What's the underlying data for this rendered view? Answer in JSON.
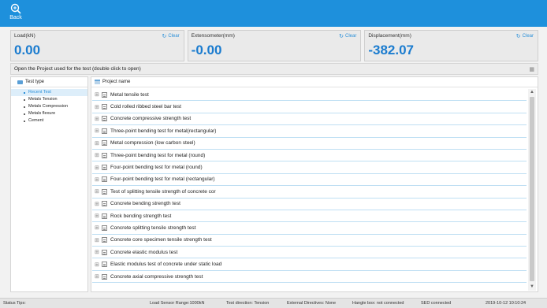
{
  "toolbar": {
    "back_label": "Back",
    "back_icon": "search-back-icon"
  },
  "sensors": [
    {
      "name": "Load(kN)",
      "clear": "Clear",
      "value": "0.00"
    },
    {
      "name": "Extensometer(mm)",
      "clear": "Clear",
      "value": "-0.00"
    },
    {
      "name": "Displacement(mm)",
      "clear": "Clear",
      "value": "-382.07"
    }
  ],
  "project_header": {
    "text": "Open the Project used for the test (double click to open)"
  },
  "left_panel": {
    "title": "Test type",
    "items": [
      {
        "label": "Recent Test",
        "active": true
      },
      {
        "label": "Metals Tension",
        "active": false
      },
      {
        "label": "Metals Compression",
        "active": false
      },
      {
        "label": "Metals flexure",
        "active": false
      },
      {
        "label": "Cement",
        "active": false
      }
    ]
  },
  "right_panel": {
    "title": "Project name",
    "projects": [
      "Metal tensile test",
      "Cold rolled ribbed steel bar test",
      "Concrete compressive strength test",
      "Three-point bending test for metal(rectangular)",
      "Metal compression (low carbon steel)",
      "Three-point bending test for metal (round)",
      "Four-point bending test for metal (round)",
      "Four-point bending test for metal (rectangular)",
      "Test of splitting tensile strength of concrete cor",
      "Concrete bending strength test",
      "Rock bending strength test",
      "Concrete splitting tensile strength test",
      "Concrete core specimen tensile strength test",
      "Concrete elastic modulus test",
      "Elastic modulus test of concrete under static load",
      "Concrete axial compressive strength test"
    ]
  },
  "status_bar": {
    "tips": "Status Tips:",
    "sensor_range": "Load Sensor Range:1000kN",
    "direction": "Test direction: Tension",
    "external": "External Directives: None",
    "handle": "Hangle box: not connected",
    "sed": "SED connected",
    "datetime": "2019-10-12 10:10:24"
  },
  "colors": {
    "accent": "#1e90dc",
    "value": "#1b7ccf",
    "row_line": "#bfdff3"
  }
}
